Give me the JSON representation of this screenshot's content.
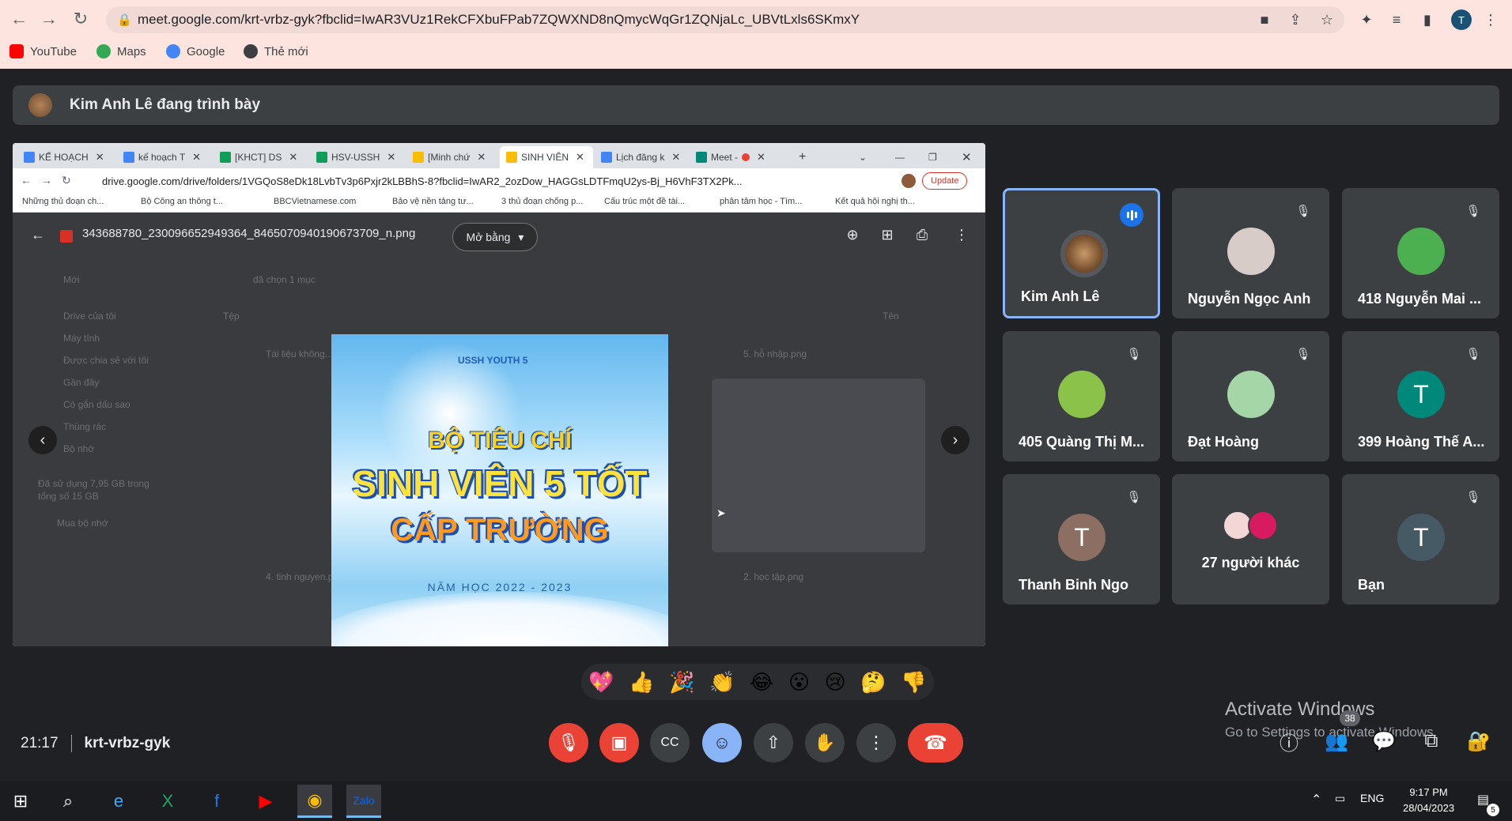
{
  "browser": {
    "url": "meet.google.com/krt-vrbz-gyk?fbclid=IwAR3VUz1RekCFXbuFPab7ZQWXND8nQmycWqGr1ZQNjaLc_UBVtLxls6SKmxY",
    "bookmarks": [
      "YouTube",
      "Maps",
      "Google",
      "Thẻ mới"
    ],
    "profile_initial": "T"
  },
  "presenting": {
    "text": "Kim Anh Lê đang trình bày"
  },
  "shared": {
    "tabs": [
      "KẾ HOẠCH",
      "kế hoạch T",
      "[KHCT] DS",
      "HSV-USSH",
      "[Minh chứ",
      "SINH VIÊN",
      "Lịch đăng k",
      "Meet -"
    ],
    "url": "drive.google.com/drive/folders/1VGQoS8eDk18LvbTv3p6Pxjr2kLBBhS-8?fbclid=IwAR2_2ozDow_HAGGsLDTFmqU2ys-Bj_H6VhF3TX2Pk...",
    "update_label": "Update",
    "bookmarks": [
      "Những thủ đoạn ch...",
      "Bộ Công an thông t...",
      "BBCVietnamese.com",
      "Bảo vệ nền tảng tư...",
      "3 thủ đoạn chống p...",
      "Cấu trúc một đề tài...",
      "phân tâm học - Tìm...",
      "Kết quả hội nghị th..."
    ],
    "file_name": "343688780_230096652949364_8465070940190673709_n.png",
    "open_with": "Mở bằng",
    "bg_texts": [
      "Mới",
      "Drive của tôi",
      "Máy tính",
      "Được chia sẻ với tôi",
      "Gần đây",
      "Có gắn dấu sao",
      "Thùng rác",
      "Bộ nhớ",
      "Đã sử dụng 7,95 GB trong",
      "tổng số 15 GB",
      "Mua bộ nhớ",
      "đã chọn 1 mục",
      "Tệp",
      "Tên",
      "Tài liệu không...",
      "5. hỗ nhập.png",
      "4. tinh nguyen.png",
      "2. học tập.png"
    ],
    "poster": {
      "line1": "BỘ TIÊU CHÍ",
      "line2": "SINH VIÊN 5 TỐT",
      "line3": "CẤP TRƯỜNG",
      "line4": "NĂM HỌC 2022 - 2023",
      "logo_text": "USSH YOUTH 5"
    }
  },
  "participants": [
    {
      "name": "Kim Anh Lê",
      "speaking": true
    },
    {
      "name": "Nguyễn Ngọc Anh",
      "muted": true
    },
    {
      "name": "418 Nguyễn Mai ...",
      "muted": true
    },
    {
      "name": "405 Quàng Thị M...",
      "muted": true
    },
    {
      "name": "Đạt Hoàng",
      "muted": true
    },
    {
      "name": "399 Hoàng Thế A...",
      "muted": true,
      "initial": "T"
    },
    {
      "name": "Thanh Binh Ngo",
      "muted": true,
      "initial": "T"
    },
    {
      "name": "27 người khác"
    },
    {
      "name": "Bạn",
      "muted": true,
      "initial": "T"
    }
  ],
  "reactions": [
    "💖",
    "👍",
    "🎉",
    "👏",
    "😂",
    "😮",
    "😢",
    "🤔",
    "👎"
  ],
  "meeting": {
    "time": "21:17",
    "code": "krt-vrbz-gyk",
    "participant_count": "38"
  },
  "watermark": {
    "line1": "Activate Windows",
    "line2": "Go to Settings to activate Windows."
  },
  "taskbar": {
    "lang": "ENG",
    "time": "9:17 PM",
    "date": "28/04/2023",
    "notif": "5"
  },
  "colors": {
    "accent": "#8ab4f8",
    "danger": "#ea4335",
    "bg": "#202124",
    "tile": "#3c4043"
  }
}
